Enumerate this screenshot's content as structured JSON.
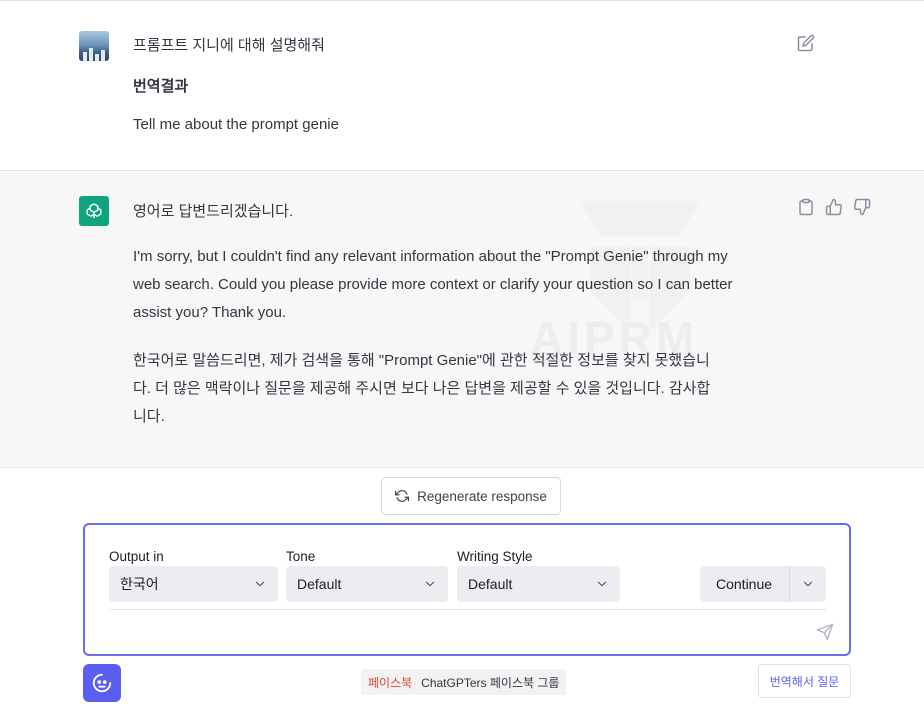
{
  "user_message": {
    "prompt": "프롬프트 지니에 대해 설명해줘",
    "translation_heading": "번역결과",
    "translation": "Tell me about the prompt genie"
  },
  "assistant_message": {
    "first_line": "영어로 답변드리겠습니다.",
    "english_paragraph": [
      "I'm sorry, but I couldn't find any relevant information about the \"Prompt Genie\" through my",
      "web search. Could you please provide more context or clarify your question so I can better",
      "assist you? Thank you."
    ],
    "korean_paragraph": [
      "한국어로 말씀드리면, 제가 검색을 통해 \"Prompt Genie\"에 관한 적절한 정보를 찾지 못했습니",
      "다. 더 많은 맥락이나 질문을 제공해 주시면 보다 나은 답변을 제공할 수 있을 것입니다. 감사합",
      "니다."
    ],
    "watermark": "AIPRM"
  },
  "regenerate": {
    "label": "Regenerate response"
  },
  "options": {
    "output_label": "Output in",
    "output_value": "한국어",
    "tone_label": "Tone",
    "tone_value": "Default",
    "style_label": "Writing Style",
    "style_value": "Default",
    "continue_label": "Continue"
  },
  "footer": {
    "facebook_label": "페이스북",
    "group_label": "ChatGPTers 페이스북 그룹",
    "translate_button": "번역해서 질문"
  },
  "colors": {
    "accent": "#5b5ff0",
    "gpt_green": "#10a37f",
    "assistant_bg": "#f7f7f8",
    "facebook_red": "#e0452c"
  },
  "icons": [
    "user-avatar",
    "edit-icon",
    "chatgpt-logo-icon",
    "clipboard-icon",
    "thumbs-up-icon",
    "thumbs-down-icon",
    "refresh-icon",
    "chevron-down-icon",
    "send-icon",
    "prompt-genie-icon"
  ]
}
